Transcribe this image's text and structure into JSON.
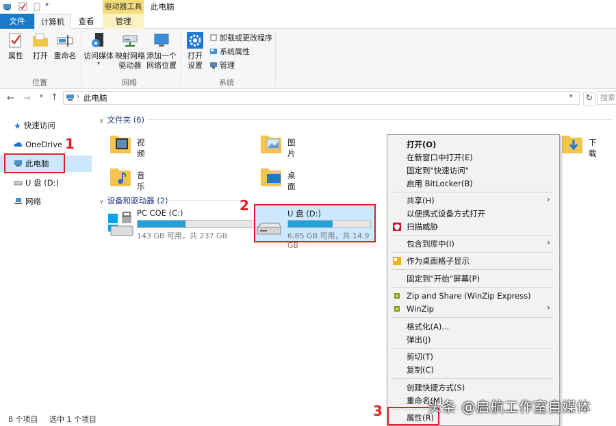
{
  "title_bar": {
    "context_tab_label": "驱动器工具",
    "window_title": "此电脑"
  },
  "tabs": {
    "file": "文件",
    "computer": "计算机",
    "view": "查看",
    "manage": "管理"
  },
  "ribbon": {
    "location": {
      "label": "位置",
      "properties": "属性",
      "open": "打开",
      "rename": "重命名"
    },
    "network": {
      "label": "网络",
      "access_media": "访问媒体",
      "map_drive_line1": "映射网络",
      "map_drive_line2": "驱动器",
      "add_location_line1": "添加一个",
      "add_location_line2": "网络位置"
    },
    "system": {
      "label": "系统",
      "open_settings_line1": "打开",
      "open_settings_line2": "设置",
      "uninstall": "卸载或更改程序",
      "system_props": "系统属性",
      "manage": "管理"
    }
  },
  "address": {
    "path": "此电脑",
    "search_placeholder": "搜索"
  },
  "nav": {
    "quick_access": "快速访问",
    "onedrive": "OneDrive",
    "this_pc": "此电脑",
    "usb": "U 盘 (D:)",
    "network": "网络"
  },
  "content": {
    "folders_header": "文件夹 (6)",
    "folders": [
      "视频",
      "图片",
      "下载",
      "音乐",
      "桌面"
    ],
    "devices_header": "设备和驱动器 (2)",
    "drives": [
      {
        "name": "PC COE (C:)",
        "space": "143 GB 可用，共 237 GB",
        "used_fraction": 0.4
      },
      {
        "name": "U 盘 (D:)",
        "space": "6.85 GB 可用，共 14.9 GB",
        "used_fraction": 0.54
      }
    ]
  },
  "context_menu": {
    "open": "打开(O)",
    "open_new_window": "在新窗口中打开(E)",
    "pin_quick": "固定到\"快速访问\"",
    "bitlocker": "启用 BitLocker(B)",
    "share": "共享(H)",
    "portable": "以便携式设备方式打开",
    "scan": "扫描威胁",
    "include_library": "包含到库中(I)",
    "tile": "作为桌面格子显示",
    "pin_start": "固定到\"开始\"屏幕(P)",
    "winzip_express": "Zip and Share (WinZip Express)",
    "winzip": "WinZip",
    "format": "格式化(A)...",
    "eject": "弹出(J)",
    "cut": "剪切(T)",
    "copy": "复制(C)",
    "shortcut": "创建快捷方式(S)",
    "rename": "重命名(M)",
    "properties": "属性(R)"
  },
  "annotations": {
    "n1": "1",
    "n2": "2",
    "n3": "3"
  },
  "status": {
    "count": "8 个项目",
    "selected": "选中 1 个项目"
  },
  "watermark": "头条 @启航工作室自媒体",
  "colors": {
    "accent": "#1979ca",
    "selection": "#cce8ff",
    "annotation": "#e02020",
    "bar_fill": "#26a0da"
  }
}
